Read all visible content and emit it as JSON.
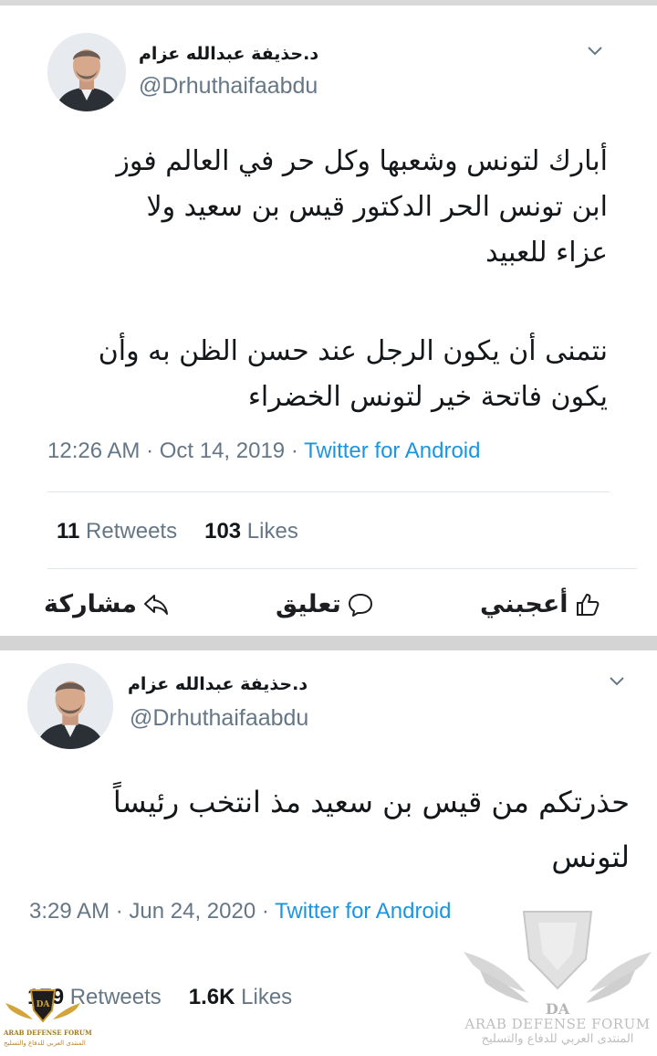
{
  "tweets": [
    {
      "display_name": "د.حذيفة عبدالله عزام",
      "handle": "@Drhuthaifaabdu",
      "paragraphs": [
        [
          "أبارك لتونس وشعبها وكل حر في العالم فوز",
          "ابن تونس الحر الدكتور قيس بن سعيد ولا",
          "عزاء للعبيد"
        ],
        [
          "نتمنى أن يكون الرجل عند حسن الظن به وأن",
          "يكون فاتحة خير لتونس الخضراء"
        ]
      ],
      "timestamp": "12:26 AM · Oct 14, 2019 · ",
      "source": "Twitter for Android",
      "retweets_count": "11",
      "retweets_label": " Retweets",
      "likes_count": "103",
      "likes_label": " Likes",
      "actions": {
        "like": "أعجبني",
        "comment": "تعليق",
        "share": "مشاركة"
      }
    },
    {
      "display_name": "د.حذيفة عبدالله عزام",
      "handle": "@Drhuthaifaabdu",
      "paragraphs": [
        [
          "حذرتكم من قيس بن سعيد مذ انتخب رئيساً",
          "لتونس"
        ]
      ],
      "timestamp": "3:29 AM · Jun 24, 2020 · ",
      "source": "Twitter for Android",
      "retweets_count": "179",
      "retweets_label": " Retweets",
      "likes_count": "1.6K",
      "likes_label": " Likes"
    }
  ],
  "watermark": {
    "logo_letters": "DA",
    "english": "ARAB DEFENSE FORUM",
    "arabic": "المنتدى العربي للدفاع والتسليح"
  },
  "badge": {
    "logo_letters": "DA",
    "english": "ARAB DEFENSE FORUM",
    "arabic": "المنتدى العربي للدفاع والتسليح"
  },
  "icons": {
    "chevron": "chevron-down-icon",
    "like": "thumbs-up-icon",
    "comment": "speech-bubble-icon",
    "share": "share-arrow-icon"
  },
  "colors": {
    "link": "#1b95e0",
    "muted": "#657786",
    "text": "#14171a",
    "separator": "#d4d4d4"
  }
}
